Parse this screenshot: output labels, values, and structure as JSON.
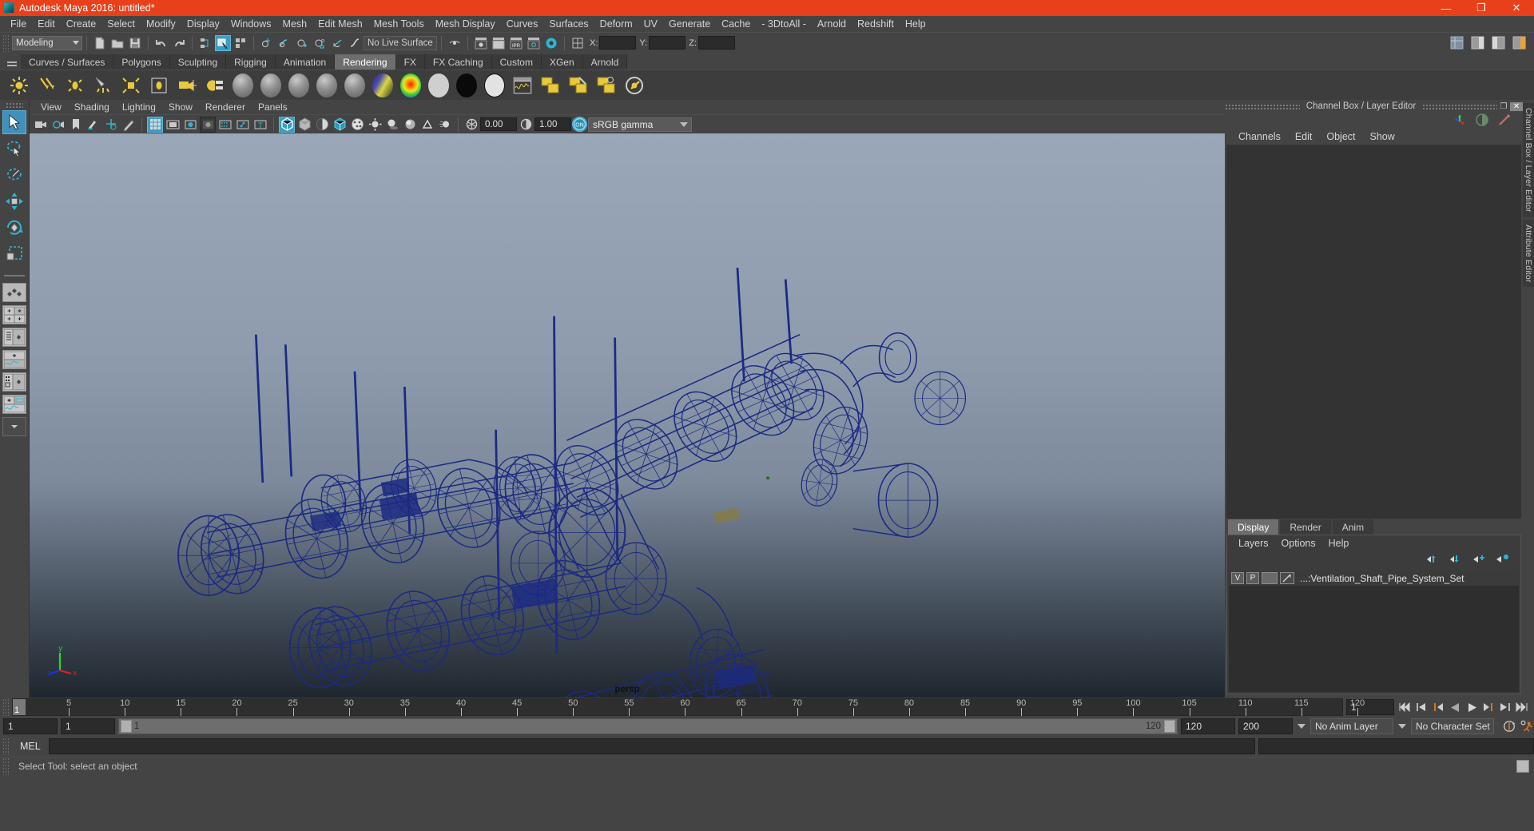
{
  "window": {
    "title": "Autodesk Maya 2016: untitled*",
    "minimize": "—",
    "maximize": "❐",
    "close": "✕"
  },
  "menubar": {
    "items": [
      "File",
      "Edit",
      "Create",
      "Select",
      "Modify",
      "Display",
      "Windows",
      "Mesh",
      "Edit Mesh",
      "Mesh Tools",
      "Mesh Display",
      "Curves",
      "Surfaces",
      "Deform",
      "UV",
      "Generate",
      "Cache",
      "- 3DtoAll -",
      "Arnold",
      "Redshift",
      "Help"
    ]
  },
  "statusbar": {
    "menuset": "Modeling",
    "live_surface": "No Live Surface",
    "coords": [
      {
        "label": "X:",
        "value": ""
      },
      {
        "label": "Y:",
        "value": ""
      },
      {
        "label": "Z:",
        "value": ""
      }
    ]
  },
  "shelf": {
    "tabs": [
      "Curves / Surfaces",
      "Polygons",
      "Sculpting",
      "Rigging",
      "Animation",
      "Rendering",
      "FX",
      "FX Caching",
      "Custom",
      "XGen",
      "Arnold"
    ],
    "active_tab": "Rendering",
    "icons": [
      "ambient-light-icon",
      "directional-light-icon",
      "point-light-icon",
      "spot-light-icon",
      "area-light-icon",
      "volume-light-icon",
      "camera-icon",
      "render-settings-icon",
      "lambert-material-icon",
      "blinn-material-icon",
      "phong-material-icon",
      "phonge-material-icon",
      "anisotropic-material-icon",
      "ramp-shader-icon",
      "ramp-texture-icon",
      "surface-shader-icon",
      "use-background-icon",
      "layered-shader-icon",
      "hypershade-icon",
      "render-view-icon",
      "batch-render-icon",
      "ipr-render-icon",
      "render-current-frame-icon"
    ]
  },
  "toolbox": {
    "tools": [
      "select-tool",
      "lasso-select-tool",
      "paint-select-tool",
      "move-tool",
      "rotate-tool",
      "scale-tool"
    ],
    "active_tool": "select-tool",
    "layouts": [
      "single-perspective-layout",
      "four-view-layout",
      "outliner-persp-layout",
      "persp-graph-layout",
      "hypershade-persp-layout",
      "persp-outliner-graph-layout",
      "layout-dropdown"
    ]
  },
  "viewport": {
    "menus": [
      "View",
      "Shading",
      "Lighting",
      "Show",
      "Renderer",
      "Panels"
    ],
    "toolbar": {
      "exposure": "0.00",
      "gamma": "1.00",
      "view_transform": "sRGB gamma",
      "view_transform_toggle": "ON"
    },
    "camera_label": "persp",
    "axis": {
      "x": "x",
      "y": "y",
      "z": "z"
    },
    "wireframe_color": "#1c2a82",
    "bg_top": "#9aa7b8",
    "bg_bottom": "#20262e"
  },
  "channelbox": {
    "title": "Channel Box / Layer Editor",
    "menus": [
      "Channels",
      "Edit",
      "Object",
      "Show"
    ],
    "icons": [
      "channel-box-icon",
      "attribute-editor-icon",
      "modeling-toolkit-icon"
    ],
    "restore": "❐",
    "close": "✕"
  },
  "layer_editor": {
    "tabs": [
      "Display",
      "Render",
      "Anim"
    ],
    "active_tab": "Display",
    "menus": [
      "Layers",
      "Options",
      "Help"
    ],
    "buttons": [
      "move-layer-up-icon",
      "move-layer-down-icon",
      "new-layer-icon",
      "new-layer-from-selected-icon"
    ],
    "layers": [
      {
        "visible": "V",
        "playback": "P",
        "type": "",
        "name": "...:Ventilation_Shaft_Pipe_System_Set"
      }
    ]
  },
  "right_tabs": [
    "Channel Box / Layer Editor",
    "Attribute Editor"
  ],
  "timeline": {
    "start_display": "1",
    "ticks": [
      5,
      10,
      15,
      20,
      25,
      30,
      35,
      40,
      45,
      50,
      55,
      60,
      65,
      70,
      75,
      80,
      85,
      90,
      95,
      100,
      105,
      110,
      115,
      120
    ],
    "current_frame": "1",
    "current_frame_field": "1",
    "playback_buttons": [
      "go-to-start-icon",
      "step-back-keyframe-icon",
      "step-back-frame-icon",
      "play-backwards-icon",
      "play-forwards-icon",
      "step-forward-frame-icon",
      "step-forward-keyframe-icon",
      "go-to-end-icon"
    ]
  },
  "range_slider": {
    "anim_start": "1",
    "range_start": "1",
    "slider_label_left": "1",
    "slider_label_right": "120",
    "range_end": "120",
    "anim_end": "200",
    "anim_layer": "No Anim Layer",
    "character_set": "No Character Set",
    "icons": [
      "auto-key-icon",
      "animation-preferences-icon"
    ]
  },
  "command_line": {
    "label": "MEL",
    "input_value": "",
    "result_value": ""
  },
  "status_line": {
    "message": "Select Tool: select an object"
  }
}
